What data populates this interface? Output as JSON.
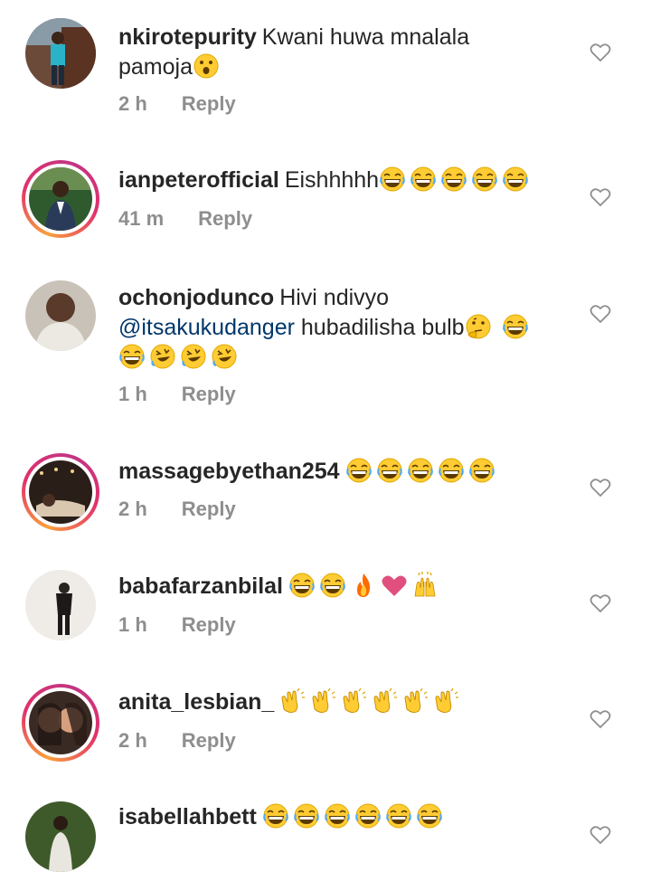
{
  "comments": [
    {
      "username": "nkirotepurity",
      "text": "Kwani huwa mnalala",
      "text2": "pamoja",
      "time": "2 h",
      "reply": "Reply"
    },
    {
      "username": "ianpeterofficial",
      "text": "Eishhhhh",
      "time": "41 m",
      "reply": "Reply"
    },
    {
      "username": "ochonjodunco",
      "text": "Hivi ndivyo",
      "mention": "@itsakukudanger",
      "text2": " hubadilisha bulb",
      "time": "1 h",
      "reply": "Reply"
    },
    {
      "username": "massagebyethan254",
      "time": "2 h",
      "reply": "Reply"
    },
    {
      "username": "babafarzanbilal",
      "time": "1 h",
      "reply": "Reply"
    },
    {
      "username": "anita_lesbian_",
      "time": "2 h",
      "reply": "Reply"
    },
    {
      "username": "isabellahbett"
    }
  ],
  "colors": {
    "text": "#262626",
    "meta": "#8e8e8e",
    "mention": "#00376b"
  }
}
